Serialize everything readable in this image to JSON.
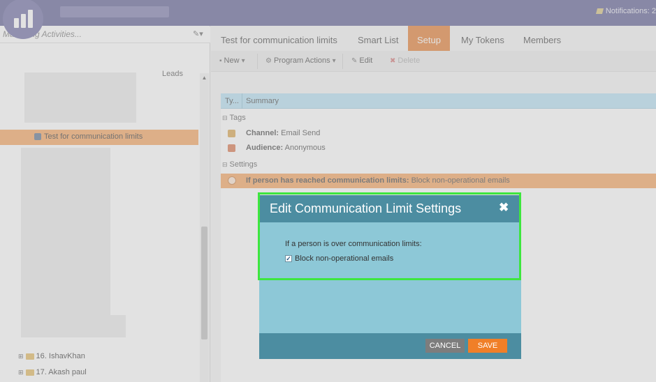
{
  "header": {
    "notifications_label": "Notifications: 2"
  },
  "sidebar": {
    "search_placeholder": "Marketing Activities...",
    "leads_label": "Leads",
    "selected_item": "Test for communication limits",
    "items": [
      {
        "label": "16. IshavKhan"
      },
      {
        "label": "17. Akash paul"
      }
    ]
  },
  "tabs": [
    {
      "label": "Test for communication limits"
    },
    {
      "label": "Smart List"
    },
    {
      "label": "Setup"
    },
    {
      "label": "My Tokens"
    },
    {
      "label": "Members"
    }
  ],
  "active_tab": "Setup",
  "toolbar": {
    "new_label": "New",
    "program_actions_label": "Program Actions",
    "edit_label": "Edit",
    "delete_label": "Delete"
  },
  "grid": {
    "columns": [
      "Ty...",
      "Summary"
    ],
    "groups": [
      {
        "label": "Tags",
        "rows": [
          {
            "key": "Channel:",
            "value": "Email Send"
          },
          {
            "key": "Audience:",
            "value": "Anonymous"
          }
        ]
      },
      {
        "label": "Settings",
        "rows": [
          {
            "key": "If person has reached communication limits:",
            "value": "Block non-operational emails"
          }
        ]
      }
    ]
  },
  "modal": {
    "title": "Edit Communication Limit Settings",
    "prompt": "If a person is over communication limits:",
    "checkbox_label": "Block non-operational emails",
    "checkbox_checked": true,
    "cancel_label": "CANCEL",
    "save_label": "SAVE"
  },
  "colors": {
    "topbar": "#5c5b92",
    "accent_orange": "#f07f28",
    "modal_header": "#4c8da1",
    "modal_body": "#8dc8d7",
    "highlight": "#3ee63e"
  }
}
